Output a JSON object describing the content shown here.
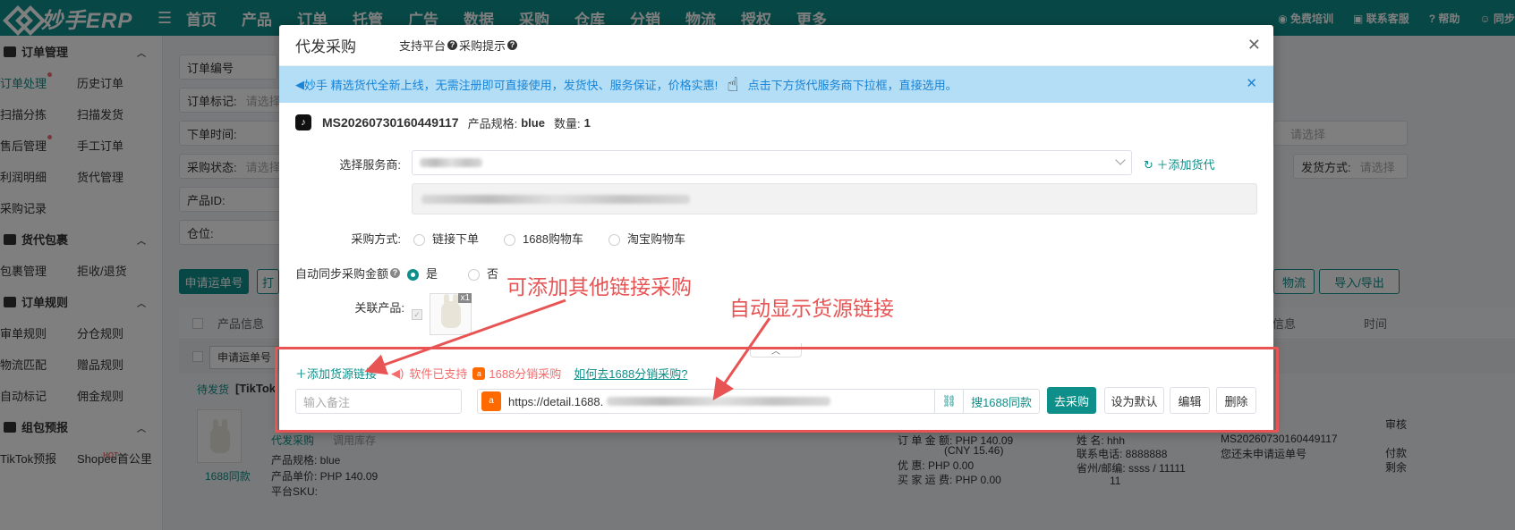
{
  "topbar": {
    "logo_text": "妙手ERP",
    "nav": [
      "首页",
      "产品",
      "订单",
      "托管",
      "广告",
      "数据",
      "采购",
      "仓库",
      "分销",
      "物流",
      "授权",
      "更多"
    ],
    "nav_dots": [
      false,
      false,
      true,
      true,
      false,
      false,
      false,
      true,
      false,
      false,
      false,
      true
    ],
    "right_links": [
      "免费培训",
      "联系客服",
      "帮助",
      "同步"
    ]
  },
  "sidebar": {
    "groups": [
      {
        "title": "订单管理",
        "rows": [
          [
            "订单处理",
            "历史订单"
          ],
          [
            "扫描分拣",
            "扫描发货"
          ],
          [
            "售后管理",
            "手工订单"
          ],
          [
            "利润明细",
            "货代管理"
          ],
          [
            "采购记录",
            ""
          ]
        ]
      },
      {
        "title": "货代包裹",
        "rows": [
          [
            "包裹管理",
            "拒收/退货"
          ]
        ]
      },
      {
        "title": "订单规则",
        "rows": [
          [
            "审单规则",
            "分仓规则"
          ],
          [
            "物流匹配",
            "赠品规则"
          ],
          [
            "自动标记",
            "佣金规则"
          ]
        ]
      },
      {
        "title": "组包预报",
        "rows": [
          [
            "TikTok预报",
            "Shopee首公里"
          ]
        ]
      }
    ],
    "hot_badge": "HOT"
  },
  "background": {
    "filters": [
      "订单编号",
      "订单标记:",
      "下单时间:",
      "采购状态:",
      "产品ID:",
      "仓位:"
    ],
    "filter_placeholder": "请选择",
    "right_filter_placeholder": "请选择",
    "shipping_label": "发货方式:",
    "apply_btn": "申请运单号",
    "apply_btn2": "打",
    "logistics_btn": "物流",
    "import_btn": "导入/导出",
    "table_headers": [
      "产品信息",
      "物流信息",
      "时间"
    ],
    "row_btn": "申请运单号",
    "status": "待发货",
    "platform": "[TikTok",
    "proxy_purchase": "代发采购",
    "use_stock": "调用库存",
    "search_same": "1688同款",
    "spec": "产品规格: blue",
    "unit_price": "产品单价: PHP 140.09",
    "sku": "平台SKU:",
    "order_amount": "订 单 金 额: PHP 140.09",
    "cny": "(CNY 15.46)",
    "discount": "优 惠: PHP 0.00",
    "shipping_fee": "买 家 运 费: PHP 0.00",
    "name": "姓 名: hhh",
    "phone": "联系电话: 8888888",
    "region": "省州/邮编: ssss / 11111",
    "region2": "11",
    "order_no_right": "MS20260730160449117",
    "no_waybill": "您还未申请运单号",
    "review": "审核",
    "paid": "付款",
    "remain": "剩余"
  },
  "modal": {
    "title": "代发采购",
    "support_platform": "支持平台",
    "purchase_tip": "采购提示",
    "notice_left": "妙手 精选货代全新上线，无需注册即可直接使用，发货快、服务保证，价格实惠!",
    "notice_right": "点击下方货代服务商下拉框，直接选用。",
    "order_no": "MS20260730160449117",
    "spec_label": "产品规格:",
    "spec_value": "blue",
    "qty_label": "数量:",
    "qty_value": "1",
    "provider_label": "选择服务商:",
    "add_agent": "添加货代",
    "method_label": "采购方式:",
    "methods": [
      "链接下单",
      "1688购物车",
      "淘宝购物车"
    ],
    "sync_label": "自动同步采购金额",
    "sync_yes": "是",
    "sync_no": "否",
    "related_label": "关联产品:",
    "qty_badge": "x1",
    "add_source": "添加货源链接",
    "support_text": "软件已支持",
    "dist_text": "1688分销采购",
    "how_link": "如何去1688分销采购?",
    "note_placeholder": "输入备注",
    "url": "https://detail.1688.",
    "search_btn": "搜1688同款",
    "buy_btn": "去采购",
    "default_btn": "设为默认",
    "edit_btn": "编辑",
    "delete_btn": "删除"
  },
  "annotations": {
    "left": "可添加其他链接采购",
    "right": "自动显示货源链接",
    "color": "#e85454"
  },
  "colors": {
    "accent": "#0e8f8a",
    "notice_bg": "#b3def5",
    "notice_text": "#1a84d6"
  }
}
